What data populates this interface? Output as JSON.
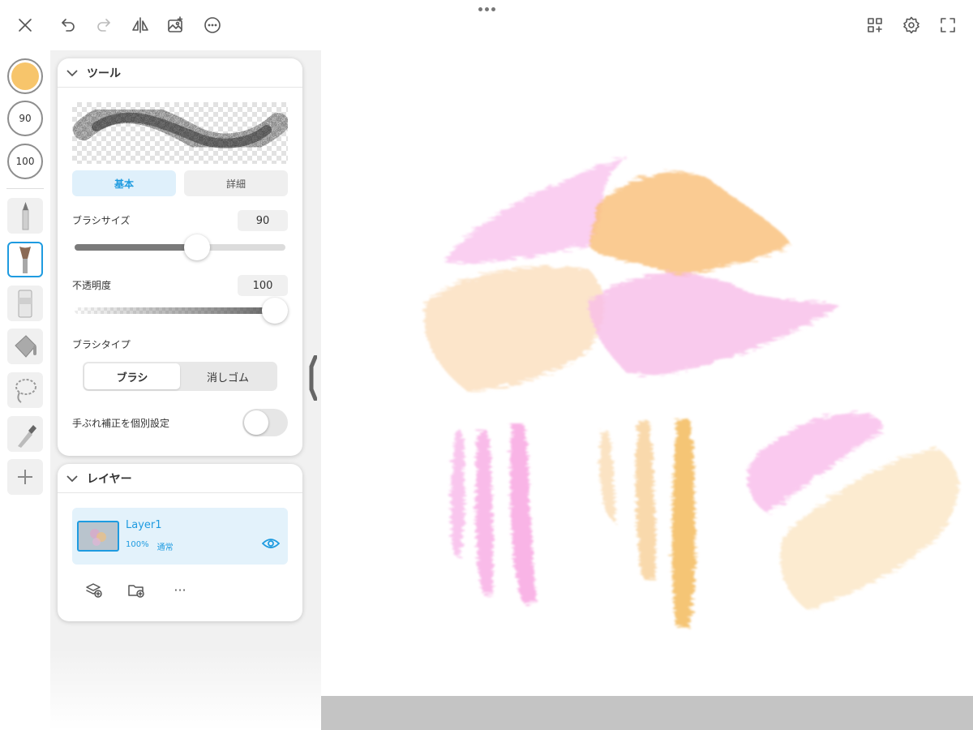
{
  "colors": {
    "accent": "#1e9be0",
    "current_color": "#f7c56b",
    "pink": "#f9b8e8",
    "peach": "#f9c88a",
    "cream": "#fbe3bf"
  },
  "topbar": {
    "icons": [
      "close-icon",
      "undo-icon",
      "redo-icon",
      "flip-icon",
      "image-icon",
      "more-icon",
      "add-grid-icon",
      "gear-icon",
      "fullscreen-icon"
    ]
  },
  "left_toolbar": {
    "brush_size": "90",
    "opacity": "100",
    "tools": [
      "pencil",
      "brush",
      "eraser",
      "bucket",
      "lasso",
      "eyedropper",
      "add"
    ],
    "active_tool": "brush"
  },
  "tool_panel": {
    "title": "ツール",
    "tab_basic": "基本",
    "tab_detail": "詳細",
    "brush_size_label": "ブラシサイズ",
    "brush_size_value": "90",
    "brush_size_fraction": 0.58,
    "opacity_label": "不透明度",
    "opacity_value": "100",
    "opacity_fraction": 0.95,
    "brush_type_label": "ブラシタイプ",
    "brush_type_brush": "ブラシ",
    "brush_type_eraser": "消しゴム",
    "stabilizer_label": "手ぶれ補正を個別設定",
    "stabilizer_on": false
  },
  "layer_panel": {
    "title": "レイヤー",
    "layers": [
      {
        "name": "Layer1",
        "opacity": "100%",
        "blend": "通常",
        "visible": true
      }
    ],
    "more": "···"
  }
}
